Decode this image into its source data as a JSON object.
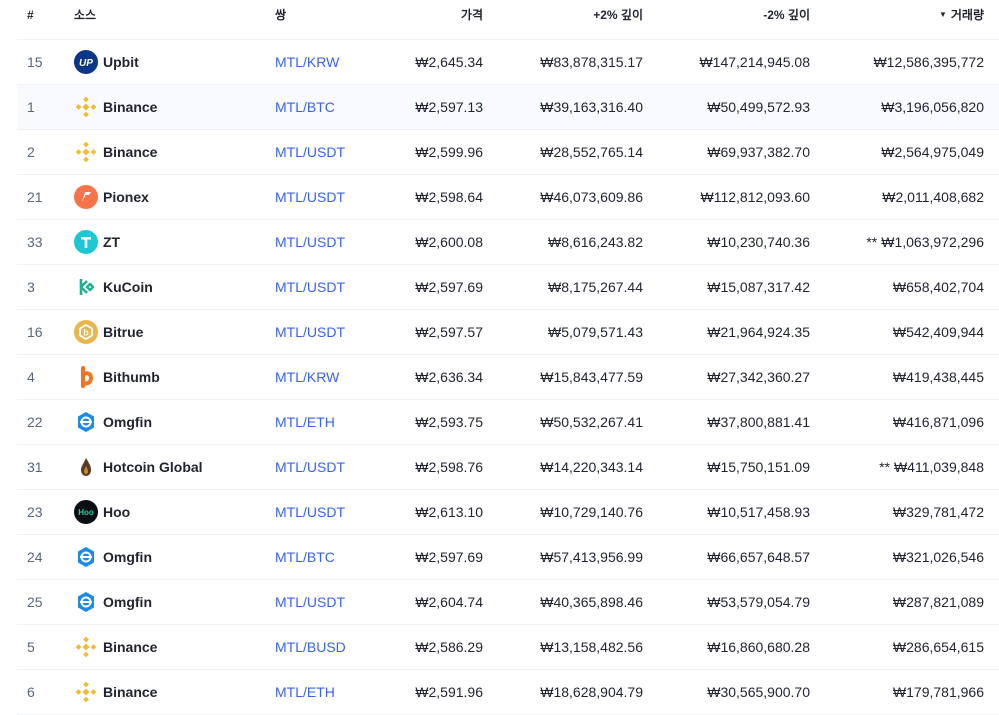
{
  "header": {
    "rank": "#",
    "source": "소스",
    "pair": "쌍",
    "price": "가격",
    "plus_depth": "+2% 깊이",
    "minus_depth": "-2% 깊이",
    "volume": "거래량",
    "volume_sort_icon": "caret-down-icon"
  },
  "colors": {
    "link": "#3861fb",
    "row_highlight": "#f8fafd",
    "text": "#222531",
    "muted": "#58667e"
  },
  "rows": [
    {
      "rank": "15",
      "exchange": "Upbit",
      "logo": "upbit-logo-icon",
      "pair": "MTL/KRW",
      "price": "₩2,645.34",
      "plus": "₩83,878,315.17",
      "minus": "₩147,214,945.08",
      "flag": "",
      "volume": "₩12,586,395,772"
    },
    {
      "rank": "1",
      "exchange": "Binance",
      "logo": "binance-logo-icon",
      "pair": "MTL/BTC",
      "price": "₩2,597.13",
      "plus": "₩39,163,316.40",
      "minus": "₩50,499,572.93",
      "flag": "",
      "volume": "₩3,196,056,820"
    },
    {
      "rank": "2",
      "exchange": "Binance",
      "logo": "binance-logo-icon",
      "pair": "MTL/USDT",
      "price": "₩2,599.96",
      "plus": "₩28,552,765.14",
      "minus": "₩69,937,382.70",
      "flag": "",
      "volume": "₩2,564,975,049"
    },
    {
      "rank": "21",
      "exchange": "Pionex",
      "logo": "pionex-logo-icon",
      "pair": "MTL/USDT",
      "price": "₩2,598.64",
      "plus": "₩46,073,609.86",
      "minus": "₩112,812,093.60",
      "flag": "",
      "volume": "₩2,011,408,682"
    },
    {
      "rank": "33",
      "exchange": "ZT",
      "logo": "zt-logo-icon",
      "pair": "MTL/USDT",
      "price": "₩2,600.08",
      "plus": "₩8,616,243.82",
      "minus": "₩10,230,740.36",
      "flag": "**",
      "volume": "₩1,063,972,296"
    },
    {
      "rank": "3",
      "exchange": "KuCoin",
      "logo": "kucoin-logo-icon",
      "pair": "MTL/USDT",
      "price": "₩2,597.69",
      "plus": "₩8,175,267.44",
      "minus": "₩15,087,317.42",
      "flag": "",
      "volume": "₩658,402,704"
    },
    {
      "rank": "16",
      "exchange": "Bitrue",
      "logo": "bitrue-logo-icon",
      "pair": "MTL/USDT",
      "price": "₩2,597.57",
      "plus": "₩5,079,571.43",
      "minus": "₩21,964,924.35",
      "flag": "",
      "volume": "₩542,409,944"
    },
    {
      "rank": "4",
      "exchange": "Bithumb",
      "logo": "bithumb-logo-icon",
      "pair": "MTL/KRW",
      "price": "₩2,636.34",
      "plus": "₩15,843,477.59",
      "minus": "₩27,342,360.27",
      "flag": "",
      "volume": "₩419,438,445"
    },
    {
      "rank": "22",
      "exchange": "Omgfin",
      "logo": "omgfin-logo-icon",
      "pair": "MTL/ETH",
      "price": "₩2,593.75",
      "plus": "₩50,532,267.41",
      "minus": "₩37,800,881.41",
      "flag": "",
      "volume": "₩416,871,096"
    },
    {
      "rank": "31",
      "exchange": "Hotcoin Global",
      "logo": "hotcoin-logo-icon",
      "pair": "MTL/USDT",
      "price": "₩2,598.76",
      "plus": "₩14,220,343.14",
      "minus": "₩15,750,151.09",
      "flag": "**",
      "volume": "₩411,039,848"
    },
    {
      "rank": "23",
      "exchange": "Hoo",
      "logo": "hoo-logo-icon",
      "pair": "MTL/USDT",
      "price": "₩2,613.10",
      "plus": "₩10,729,140.76",
      "minus": "₩10,517,458.93",
      "flag": "",
      "volume": "₩329,781,472"
    },
    {
      "rank": "24",
      "exchange": "Omgfin",
      "logo": "omgfin-logo-icon",
      "pair": "MTL/BTC",
      "price": "₩2,597.69",
      "plus": "₩57,413,956.99",
      "minus": "₩66,657,648.57",
      "flag": "",
      "volume": "₩321,026,546"
    },
    {
      "rank": "25",
      "exchange": "Omgfin",
      "logo": "omgfin-logo-icon",
      "pair": "MTL/USDT",
      "price": "₩2,604.74",
      "plus": "₩40,365,898.46",
      "minus": "₩53,579,054.79",
      "flag": "",
      "volume": "₩287,821,089"
    },
    {
      "rank": "5",
      "exchange": "Binance",
      "logo": "binance-logo-icon",
      "pair": "MTL/BUSD",
      "price": "₩2,586.29",
      "plus": "₩13,158,482.56",
      "minus": "₩16,860,680.28",
      "flag": "",
      "volume": "₩286,654,615"
    },
    {
      "rank": "6",
      "exchange": "Binance",
      "logo": "binance-logo-icon",
      "pair": "MTL/ETH",
      "price": "₩2,591.96",
      "plus": "₩18,628,904.79",
      "minus": "₩30,565,900.70",
      "flag": "",
      "volume": "₩179,781,966"
    }
  ]
}
